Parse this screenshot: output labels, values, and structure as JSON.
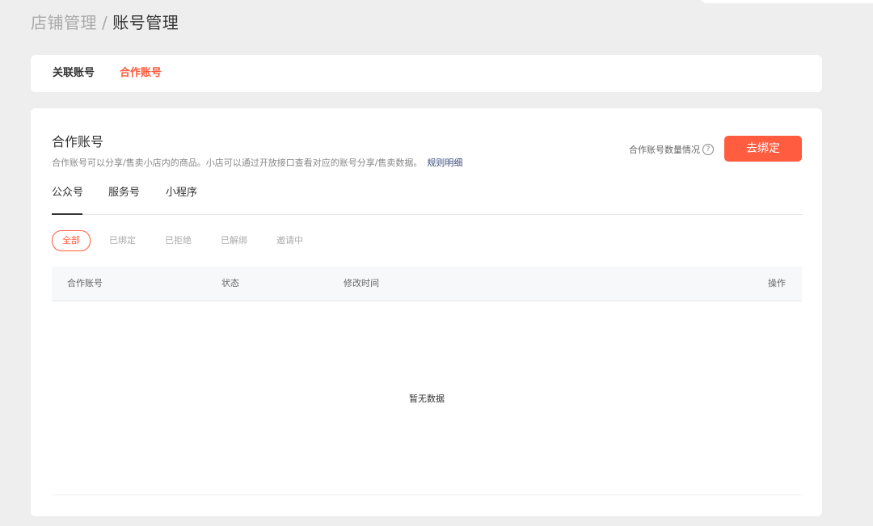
{
  "breadcrumb": {
    "parent": "店铺管理",
    "separator": "/",
    "current": "账号管理"
  },
  "top_tabs": [
    {
      "label": "关联账号",
      "active": false
    },
    {
      "label": "合作账号",
      "active": true
    }
  ],
  "section": {
    "title": "合作账号",
    "description": "合作账号可以分享/售卖小店内的商品。小店可以通过开放接口查看对应的账号分享/售卖数据。",
    "rule_link": "规则明细",
    "quota_label": "合作账号数量情况",
    "help_glyph": "?",
    "bind_button": "去绑定"
  },
  "sub_tabs": [
    {
      "label": "公众号",
      "active": true
    },
    {
      "label": "服务号",
      "active": false
    },
    {
      "label": "小程序",
      "active": false
    }
  ],
  "filters": [
    {
      "label": "全部",
      "active": true
    },
    {
      "label": "已绑定",
      "active": false
    },
    {
      "label": "已拒绝",
      "active": false
    },
    {
      "label": "已解绑",
      "active": false
    },
    {
      "label": "邀请中",
      "active": false
    }
  ],
  "table": {
    "columns": [
      "合作账号",
      "状态",
      "修改时间",
      "操作"
    ],
    "rows": [],
    "empty_text": "暂无数据"
  },
  "colors": {
    "accent": "#ff5c40",
    "background": "#eeeeee",
    "link": "#3a4a7a"
  }
}
